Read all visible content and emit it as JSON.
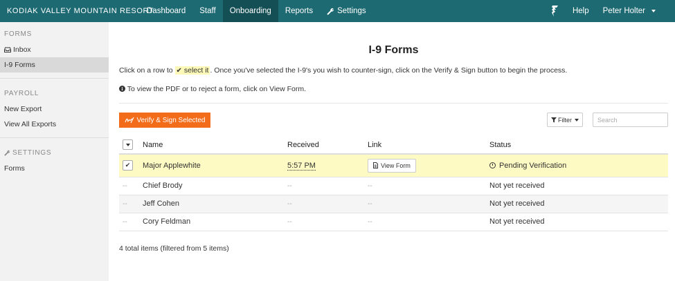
{
  "header": {
    "brand": "KODIAK VALLEY MOUNTAIN RESORT",
    "nav": [
      {
        "label": "Dashboard",
        "active": false
      },
      {
        "label": "Staff",
        "active": false
      },
      {
        "label": "Onboarding",
        "active": true
      },
      {
        "label": "Reports",
        "active": false
      },
      {
        "label": "Settings",
        "active": false,
        "icon": "wrench-icon"
      }
    ],
    "help_label": "Help",
    "user_label": "Peter Holter"
  },
  "sidebar": {
    "sections": [
      {
        "heading": "FORMS",
        "items": [
          {
            "label": "Inbox",
            "icon": "inbox-icon",
            "active": false
          },
          {
            "label": "I-9 Forms",
            "active": true
          }
        ]
      },
      {
        "heading": "PAYROLL",
        "items": [
          {
            "label": "New Export",
            "active": false
          },
          {
            "label": "View All Exports",
            "active": false
          }
        ]
      },
      {
        "heading": "SETTINGS",
        "icon": "wrench-icon",
        "items": [
          {
            "label": "Forms",
            "active": false
          }
        ]
      }
    ]
  },
  "main": {
    "title": "I-9 Forms",
    "instruction_pre": "Click on a row to",
    "instruction_highlight": "select it",
    "instruction_post": ". Once you've selected the I-9's you wish to counter-sign, click on the Verify & Sign button to begin the process.",
    "info_text": "To view the PDF or to reject a form, click on View Form.",
    "verify_button": "Verify & Sign Selected",
    "filter_button": "Filter",
    "search_placeholder": "Search",
    "columns": {
      "name": "Name",
      "received": "Received",
      "link": "Link",
      "status": "Status"
    },
    "rows": [
      {
        "name": "Major Applewhite",
        "received": "5:57 PM",
        "link": "View Form",
        "status": "Pending Verification",
        "checkbox": "checked"
      },
      {
        "name": "Chief Brody",
        "received": "--",
        "link": "--",
        "status": "Not yet received",
        "checkbox": "--"
      },
      {
        "name": "Jeff Cohen",
        "received": "--",
        "link": "--",
        "status": "Not yet received",
        "checkbox": "--"
      },
      {
        "name": "Cory Feldman",
        "received": "--",
        "link": "--",
        "status": "Not yet received",
        "checkbox": "--"
      }
    ],
    "total_text": "4 total items (filtered from 5 items)"
  },
  "colors": {
    "navbar": "#1d6a73",
    "navbar_active": "#154f56",
    "verify_button": "#f26c1a",
    "selected_row": "#fdfbc3"
  }
}
